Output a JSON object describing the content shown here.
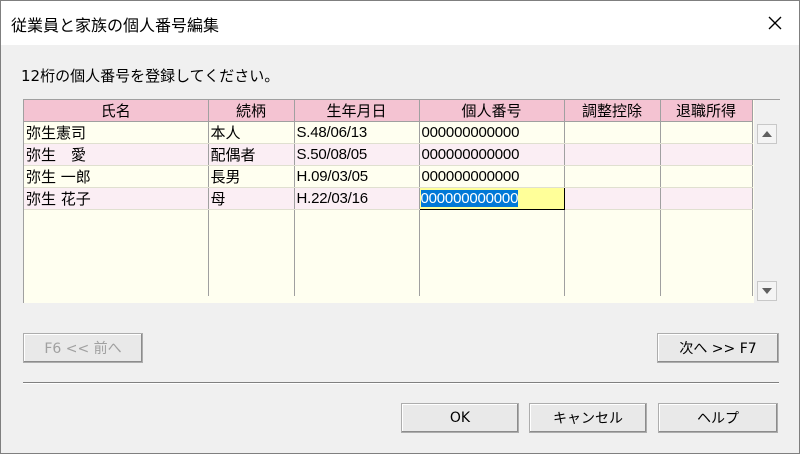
{
  "window": {
    "title": "従業員と家族の個人番号編集",
    "close_icon": "close-icon"
  },
  "instruction": "12桁の個人番号を登録してください。",
  "grid": {
    "columns": [
      "氏名",
      "続柄",
      "生年月日",
      "個人番号",
      "調整控除",
      "退職所得"
    ],
    "rows": [
      {
        "name": "弥生憲司",
        "relation": "本人",
        "birth": "S.48/06/13",
        "number": "000000000000",
        "adjust": "",
        "retire": ""
      },
      {
        "name": "弥生　愛",
        "relation": "配偶者",
        "birth": "S.50/08/05",
        "number": "000000000000",
        "adjust": "",
        "retire": ""
      },
      {
        "name": "弥生 一郎",
        "relation": "長男",
        "birth": "H.09/03/05",
        "number": "000000000000",
        "adjust": "",
        "retire": ""
      },
      {
        "name": "弥生 花子",
        "relation": "母",
        "birth": "H.22/03/16",
        "number": "000000000000",
        "adjust": "",
        "retire": ""
      }
    ],
    "selected_row": 3,
    "selected_column": "個人番号",
    "colors": {
      "header": "#f4c3d2",
      "row_odd": "#fffff0",
      "row_even": "#fbeef4",
      "selection": "#0078d7",
      "active_cell": "#ffff99"
    }
  },
  "nav": {
    "prev_label": "F6 << 前へ",
    "prev_enabled": false,
    "next_label": "次へ >> F7"
  },
  "footer": {
    "ok_label": "OK",
    "cancel_label": "キャンセル",
    "help_label": "ヘルプ"
  }
}
